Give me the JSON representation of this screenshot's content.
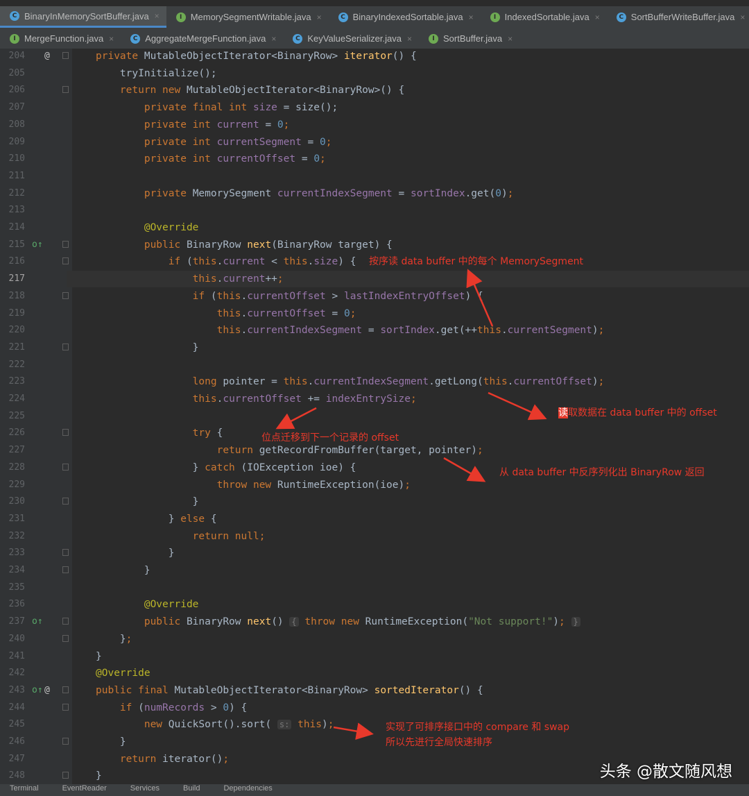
{
  "tabs_row1": [
    {
      "label": "BinaryInMemorySortBuffer.java",
      "type": "C",
      "active": true
    },
    {
      "label": "MemorySegmentWritable.java",
      "type": "I",
      "active": false
    },
    {
      "label": "BinaryIndexedSortable.java",
      "type": "C",
      "active": false
    },
    {
      "label": "IndexedSortable.java",
      "type": "I",
      "active": false
    },
    {
      "label": "SortBufferWriteBuffer.java",
      "type": "C",
      "active": false
    }
  ],
  "tabs_row2": [
    {
      "label": "MergeFunction.java",
      "type": "I",
      "active": false
    },
    {
      "label": "AggregateMergeFunction.java",
      "type": "C",
      "active": false
    },
    {
      "label": "KeyValueSerializer.java",
      "type": "C",
      "active": false
    },
    {
      "label": "SortBuffer.java",
      "type": "I",
      "active": false
    }
  ],
  "tab_close_glyph": "×",
  "current_line": "217",
  "code_lines": [
    {
      "n": "204",
      "mark": "@",
      "t": [
        [
          "kw",
          "private "
        ],
        [
          "",
          "MutableObjectIterator<BinaryRow> "
        ],
        [
          "fn",
          "iterator"
        ],
        [
          "",
          "() {"
        ]
      ]
    },
    {
      "n": "205",
      "t": [
        [
          "",
          "    tryInitialize();"
        ]
      ]
    },
    {
      "n": "206",
      "t": [
        [
          "kw",
          "    return new "
        ],
        [
          "",
          "MutableObjectIterator<BinaryRow>() {"
        ]
      ]
    },
    {
      "n": "207",
      "t": [
        [
          "kw",
          "        private final int "
        ],
        [
          "fld",
          "size"
        ],
        [
          "",
          " = size();"
        ]
      ]
    },
    {
      "n": "208",
      "t": [
        [
          "kw",
          "        private int "
        ],
        [
          "fld",
          "current"
        ],
        [
          "",
          " = "
        ],
        [
          "num",
          "0"
        ],
        [
          "kw",
          ";"
        ]
      ]
    },
    {
      "n": "209",
      "t": [
        [
          "kw",
          "        private int "
        ],
        [
          "fld",
          "currentSegment"
        ],
        [
          "",
          " = "
        ],
        [
          "num",
          "0"
        ],
        [
          "kw",
          ";"
        ]
      ]
    },
    {
      "n": "210",
      "t": [
        [
          "kw",
          "        private int "
        ],
        [
          "fld",
          "currentOffset"
        ],
        [
          "",
          " = "
        ],
        [
          "num",
          "0"
        ],
        [
          "kw",
          ";"
        ]
      ]
    },
    {
      "n": "211",
      "t": []
    },
    {
      "n": "212",
      "t": [
        [
          "kw",
          "        private "
        ],
        [
          "",
          "MemorySegment "
        ],
        [
          "fld",
          "currentIndexSegment"
        ],
        [
          "",
          " = "
        ],
        [
          "fld",
          "sortIndex"
        ],
        [
          "",
          ".get("
        ],
        [
          "num",
          "0"
        ],
        [
          "",
          ")"
        ],
        [
          "kw",
          ";"
        ]
      ]
    },
    {
      "n": "213",
      "t": []
    },
    {
      "n": "214",
      "t": [
        [
          "ann",
          "        @Override"
        ]
      ]
    },
    {
      "n": "215",
      "mark": "o↑",
      "t": [
        [
          "kw",
          "        public "
        ],
        [
          "",
          "BinaryRow "
        ],
        [
          "fn",
          "next"
        ],
        [
          "",
          "(BinaryRow target) {"
        ]
      ]
    },
    {
      "n": "216",
      "t": [
        [
          "kw",
          "            if "
        ],
        [
          "",
          "("
        ],
        [
          "kw",
          "this"
        ],
        [
          "",
          "."
        ],
        [
          "fld",
          "current"
        ],
        [
          "",
          " < "
        ],
        [
          "kw",
          "this"
        ],
        [
          "",
          "."
        ],
        [
          "fld",
          "size"
        ],
        [
          "",
          ") {"
        ]
      ]
    },
    {
      "n": "217",
      "t": [
        [
          "kw",
          "                this"
        ],
        [
          "",
          "."
        ],
        [
          "fld",
          "current"
        ],
        [
          "",
          "++"
        ],
        [
          "kw",
          ";"
        ]
      ]
    },
    {
      "n": "218",
      "t": [
        [
          "kw",
          "                if "
        ],
        [
          "",
          "("
        ],
        [
          "kw",
          "this"
        ],
        [
          "",
          "."
        ],
        [
          "fld",
          "currentOffset"
        ],
        [
          "",
          " > "
        ],
        [
          "fld",
          "lastIndexEntryOffset"
        ],
        [
          "",
          ") {"
        ]
      ]
    },
    {
      "n": "219",
      "t": [
        [
          "kw",
          "                    this"
        ],
        [
          "",
          "."
        ],
        [
          "fld",
          "currentOffset"
        ],
        [
          "",
          " = "
        ],
        [
          "num",
          "0"
        ],
        [
          "kw",
          ";"
        ]
      ]
    },
    {
      "n": "220",
      "t": [
        [
          "kw",
          "                    this"
        ],
        [
          "",
          "."
        ],
        [
          "fld",
          "currentIndexSegment"
        ],
        [
          "",
          " = "
        ],
        [
          "fld",
          "sortIndex"
        ],
        [
          "",
          ".get(++"
        ],
        [
          "kw",
          "this"
        ],
        [
          "",
          "."
        ],
        [
          "fld",
          "currentSegment"
        ],
        [
          "",
          ")"
        ],
        [
          "kw",
          ";"
        ]
      ]
    },
    {
      "n": "221",
      "t": [
        [
          "",
          "                }"
        ]
      ]
    },
    {
      "n": "222",
      "t": []
    },
    {
      "n": "223",
      "t": [
        [
          "kw",
          "                long "
        ],
        [
          "",
          "pointer = "
        ],
        [
          "kw",
          "this"
        ],
        [
          "",
          "."
        ],
        [
          "fld",
          "currentIndexSegment"
        ],
        [
          "",
          ".getLong("
        ],
        [
          "kw",
          "this"
        ],
        [
          "",
          "."
        ],
        [
          "fld",
          "currentOffset"
        ],
        [
          "",
          ")"
        ],
        [
          "kw",
          ";"
        ]
      ]
    },
    {
      "n": "224",
      "t": [
        [
          "kw",
          "                this"
        ],
        [
          "",
          "."
        ],
        [
          "fld",
          "currentOffset"
        ],
        [
          "",
          " += "
        ],
        [
          "fld",
          "indexEntrySize"
        ],
        [
          "kw",
          ";"
        ]
      ]
    },
    {
      "n": "225",
      "t": []
    },
    {
      "n": "226",
      "t": [
        [
          "kw",
          "                try "
        ],
        [
          "",
          "{"
        ]
      ]
    },
    {
      "n": "227",
      "t": [
        [
          "kw",
          "                    return "
        ],
        [
          "",
          "getRecordFromBuffer(target, pointer)"
        ],
        [
          "kw",
          ";"
        ]
      ]
    },
    {
      "n": "228",
      "t": [
        [
          "",
          "                } "
        ],
        [
          "kw",
          "catch "
        ],
        [
          "",
          "(IOException ioe) {"
        ]
      ]
    },
    {
      "n": "229",
      "t": [
        [
          "kw",
          "                    throw new "
        ],
        [
          "",
          "RuntimeException(ioe)"
        ],
        [
          "kw",
          ";"
        ]
      ]
    },
    {
      "n": "230",
      "t": [
        [
          "",
          "                }"
        ]
      ]
    },
    {
      "n": "231",
      "t": [
        [
          "",
          "            } "
        ],
        [
          "kw",
          "else "
        ],
        [
          "",
          "{"
        ]
      ]
    },
    {
      "n": "232",
      "t": [
        [
          "kw",
          "                return null;"
        ]
      ]
    },
    {
      "n": "233",
      "t": [
        [
          "",
          "            }"
        ]
      ]
    },
    {
      "n": "234",
      "t": [
        [
          "",
          "        }"
        ]
      ]
    },
    {
      "n": "235",
      "t": []
    },
    {
      "n": "236",
      "t": [
        [
          "ann",
          "        @Override"
        ]
      ]
    },
    {
      "n": "237",
      "mark": "o↑",
      "t": [
        [
          "kw",
          "        public "
        ],
        [
          "",
          "BinaryRow "
        ],
        [
          "fn",
          "next"
        ],
        [
          "",
          "() "
        ],
        [
          "hint",
          "{"
        ],
        [
          "",
          " "
        ],
        [
          "kw",
          "throw new "
        ],
        [
          "",
          "RuntimeException("
        ],
        [
          "str",
          "\"Not support!\""
        ],
        [
          "",
          ")"
        ],
        [
          "kw",
          ";"
        ],
        [
          "",
          " "
        ],
        [
          "hint",
          "}"
        ]
      ]
    },
    {
      "n": "240",
      "t": [
        [
          "",
          "    }"
        ],
        [
          "kw",
          ";"
        ]
      ]
    },
    {
      "n": "241",
      "t": [
        [
          "",
          "}"
        ]
      ]
    },
    {
      "n": "242",
      "t": [
        [
          "ann",
          "@Override"
        ]
      ]
    },
    {
      "n": "243",
      "mark": "o↑@",
      "t": [
        [
          "kw",
          "public final "
        ],
        [
          "",
          "MutableObjectIterator<BinaryRow> "
        ],
        [
          "fn",
          "sortedIterator"
        ],
        [
          "",
          "() {"
        ]
      ]
    },
    {
      "n": "244",
      "t": [
        [
          "kw",
          "    if "
        ],
        [
          "",
          "("
        ],
        [
          "fld",
          "numRecords"
        ],
        [
          "",
          " > "
        ],
        [
          "num",
          "0"
        ],
        [
          "",
          ") {"
        ]
      ]
    },
    {
      "n": "245",
      "t": [
        [
          "kw",
          "        new "
        ],
        [
          "",
          "QuickSort().sort( "
        ],
        [
          "hint",
          "s:"
        ],
        [
          "kw",
          " this"
        ],
        [
          "",
          ")"
        ],
        [
          "kw",
          ";"
        ]
      ]
    },
    {
      "n": "246",
      "t": [
        [
          "",
          "    }"
        ]
      ]
    },
    {
      "n": "247",
      "t": [
        [
          "kw",
          "    return "
        ],
        [
          "",
          "iterator()"
        ],
        [
          "kw",
          ";"
        ]
      ]
    },
    {
      "n": "248",
      "t": [
        [
          "",
          "}"
        ]
      ]
    }
  ],
  "annotations": {
    "a1": "按序读 data buffer 中的每个 MemorySegment",
    "a2": "读取数据在 data buffer 中的 offset",
    "a3": "位点迁移到下一个记录的 offset",
    "a4": "从 data buffer 中反序列化出 BinaryRow 返回",
    "a5_line1": "实现了可排序接口中的 compare 和 swap",
    "a5_line2": "所以先进行全局快速排序"
  },
  "bottom_tools": [
    "Terminal",
    "EventReader",
    "Services",
    "Build",
    "Dependencies"
  ],
  "watermark": "头条 @散文随风想",
  "colors": {
    "keyword": "#cc7832",
    "method": "#ffc66d",
    "number": "#6897bb",
    "field": "#9876aa",
    "annotation": "#bbb529",
    "string": "#6a8759",
    "note": "#e8392b",
    "tab_accent": "#4a88c7"
  }
}
